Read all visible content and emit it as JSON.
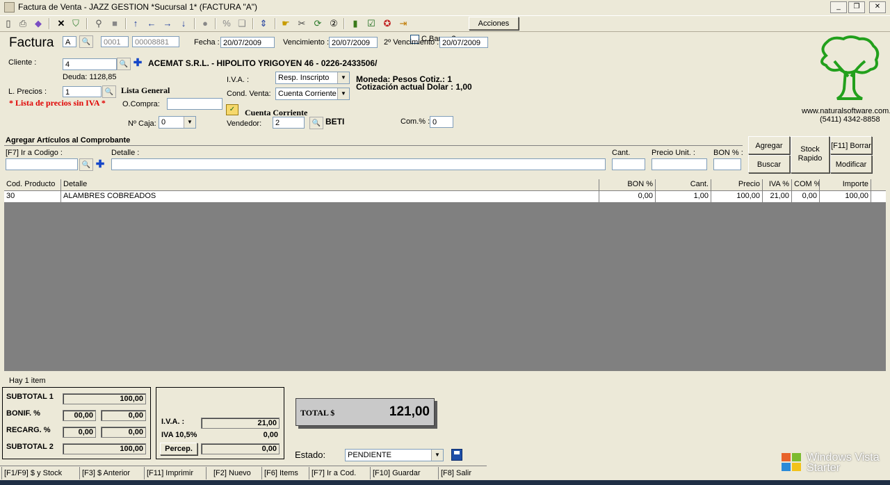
{
  "window": {
    "title": "Factura de Venta - JAZZ GESTION *Sucursal 1* (FACTURA \"A\")"
  },
  "toolbar": {
    "cbarras_label": "C.Barras?",
    "acciones_label": "Acciones"
  },
  "header": {
    "factura_label": "Factura",
    "tipo": "A",
    "punto_venta": "0001",
    "numero": "00008881",
    "fecha_label": "Fecha :",
    "fecha": "20/07/2009",
    "vencimiento_label": "Vencimiento :",
    "vencimiento": "20/07/2009",
    "vencimiento2_label": "2º Vencimiento :",
    "vencimiento2": "20/07/2009"
  },
  "cliente": {
    "label": "Cliente :",
    "codigo": "4",
    "nombre": "ACEMAT S.R.L. - HIPOLITO YRIGOYEN 46 - 0226-2433506/",
    "deuda": "Deuda: 1128,85"
  },
  "precios": {
    "label": "L. Precios :",
    "codigo": "1",
    "lista": "Lista General",
    "aviso": "* Lista de precios sin IVA *"
  },
  "ocompra": {
    "label": "O.Compra:",
    "value": ""
  },
  "caja": {
    "label": "Nº Caja:",
    "value": "0"
  },
  "iva": {
    "label": "I.V.A. :",
    "value": "Resp. Inscripto"
  },
  "cond_venta": {
    "label": "Cond. Venta:",
    "value": "Cuenta Corriente",
    "titulo": "Cuenta Corriente"
  },
  "vendedor": {
    "label": "Vendedor:",
    "codigo": "2",
    "nombre": "BETI"
  },
  "moneda": {
    "linea1": "Moneda: Pesos Cotiz.: 1",
    "linea2": "Cotización actual Dolar : 1,00"
  },
  "comision": {
    "label": "Com.% :",
    "value": "0"
  },
  "brand": {
    "web": "www.naturalsoftware.com.ar",
    "telefono": "(5411) 4342-8858",
    "tree_color": "#22a01c"
  },
  "agregar": {
    "titulo": "Agregar Artículos al Comprobante",
    "codigo_label": "[F7] Ir a Codigo :",
    "detalle_label": "Detalle :",
    "cant_label": "Cant.",
    "precio_label": "Precio Unit. :",
    "bon_label": "BON % :",
    "btn_agregar": "Agregar",
    "btn_buscar": "Buscar",
    "btn_stock1": "Stock",
    "btn_stock2": "Rapido",
    "btn_borrar": "[F11] Borrar",
    "btn_modificar": "Modificar"
  },
  "table": {
    "columns": [
      "Cod. Producto",
      "Detalle",
      "BON %",
      "Cant.",
      "Precio",
      "IVA %",
      "COM %",
      "Importe"
    ],
    "rows": [
      [
        "30",
        "ALAMBRES COBREADOS",
        "0,00",
        "1,00",
        "100,00",
        "21,00",
        "0,00",
        "100,00"
      ]
    ]
  },
  "count": "Hay 1 item",
  "totales": {
    "subtotal1_label": "SUBTOTAL 1",
    "subtotal1": "100,00",
    "bonif_label": "BONIF. %",
    "bonif_pct": "00,00",
    "bonif": "0,00",
    "recarg_label": "RECARG. %",
    "recarg_pct": "0,00",
    "recarg": "0,00",
    "subtotal2_label": "SUBTOTAL 2",
    "subtotal2": "100,00",
    "iva_label": "I.V.A. :",
    "iva": "21,00",
    "iva105_label": "IVA 10,5%",
    "iva105": "0,00",
    "percep_label": "Percep.",
    "percep": "0,00",
    "total_label": "TOTAL $",
    "total": "121,00"
  },
  "estado": {
    "label": "Estado:",
    "value": "PENDIENTE"
  },
  "fkeys": [
    "[F1/F9] $ y Stock",
    "[F3] $ Anterior",
    "[F11] Imprimir",
    "[F2] Nuevo",
    "[F6] Items",
    "[F7] Ir a Cod.",
    "[F10] Guardar",
    "[F8] Salir"
  ],
  "os": {
    "line1": "Windows Vista",
    "line2": "Starter"
  }
}
